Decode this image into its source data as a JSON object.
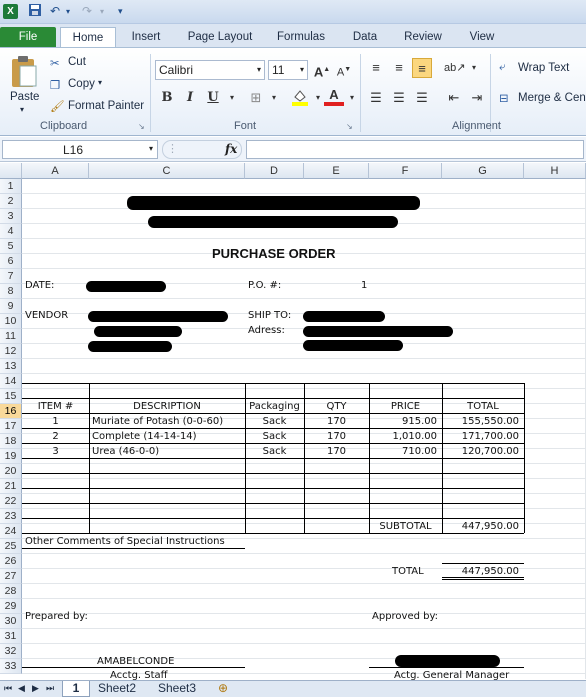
{
  "qat": {
    "logo": "X"
  },
  "tabs": [
    "File",
    "Home",
    "Insert",
    "Page Layout",
    "Formulas",
    "Data",
    "Review",
    "View"
  ],
  "clipboard": {
    "paste": "Paste",
    "cut": "Cut",
    "copy": "Copy",
    "painter": "Format Painter",
    "label": "Clipboard"
  },
  "font": {
    "name": "Calibri",
    "size": "11",
    "bold": "B",
    "italic": "I",
    "underline": "U",
    "label": "Font"
  },
  "alignment": {
    "wrap": "Wrap Text",
    "merge": "Merge & Cen",
    "label": "Alignment"
  },
  "formula_bar": {
    "name_box": "L16",
    "fx": "fx",
    "formula": ""
  },
  "columns": [
    "A",
    "C",
    "D",
    "E",
    "F",
    "G",
    "H"
  ],
  "rows": [
    "1",
    "2",
    "3",
    "4",
    "5",
    "6",
    "7",
    "8",
    "9",
    "10",
    "11",
    "12",
    "13",
    "14",
    "15",
    "16",
    "17",
    "18",
    "19",
    "20",
    "21",
    "22",
    "23",
    "24",
    "25",
    "26",
    "27",
    "28",
    "29",
    "30",
    "31",
    "32",
    "33"
  ],
  "sheet": {
    "title": "PURCHASE ORDER",
    "date_label": "DATE:",
    "po_label": "P.O. #:",
    "po_value": "1",
    "vendor_label": "VENDOR",
    "ship_label": "SHIP TO:",
    "address_label": "Adress:",
    "headers": [
      "ITEM #",
      "DESCRIPTION",
      "Packaging",
      "QTY",
      "PRICE",
      "TOTAL"
    ],
    "items": [
      {
        "item": "1",
        "desc": "Muriate of Potash (0-0-60)",
        "pack": "Sack",
        "qty": "170",
        "price": "915.00",
        "total": "155,550.00"
      },
      {
        "item": "2",
        "desc": "Complete (14-14-14)",
        "pack": "Sack",
        "qty": "170",
        "price": "1,010.00",
        "total": "171,700.00"
      },
      {
        "item": "3",
        "desc": "Urea (46-0-0)",
        "pack": "Sack",
        "qty": "170",
        "price": "710.00",
        "total": "120,700.00"
      }
    ],
    "subtotal_label": "SUBTOTAL",
    "subtotal_value": "447,950.00",
    "comments_label": "Other Comments of Special Instructions",
    "total_label": "TOTAL",
    "total_value": "447,950.00",
    "prepared_label": "Prepared by:",
    "approved_label": "Approved by:",
    "preparer_name": "AMABELCONDE",
    "preparer_title": "Acctg. Staff",
    "approver_title": "Actg. General Manager"
  },
  "sheet_tabs": [
    "1",
    "Sheet2",
    "Sheet3"
  ]
}
